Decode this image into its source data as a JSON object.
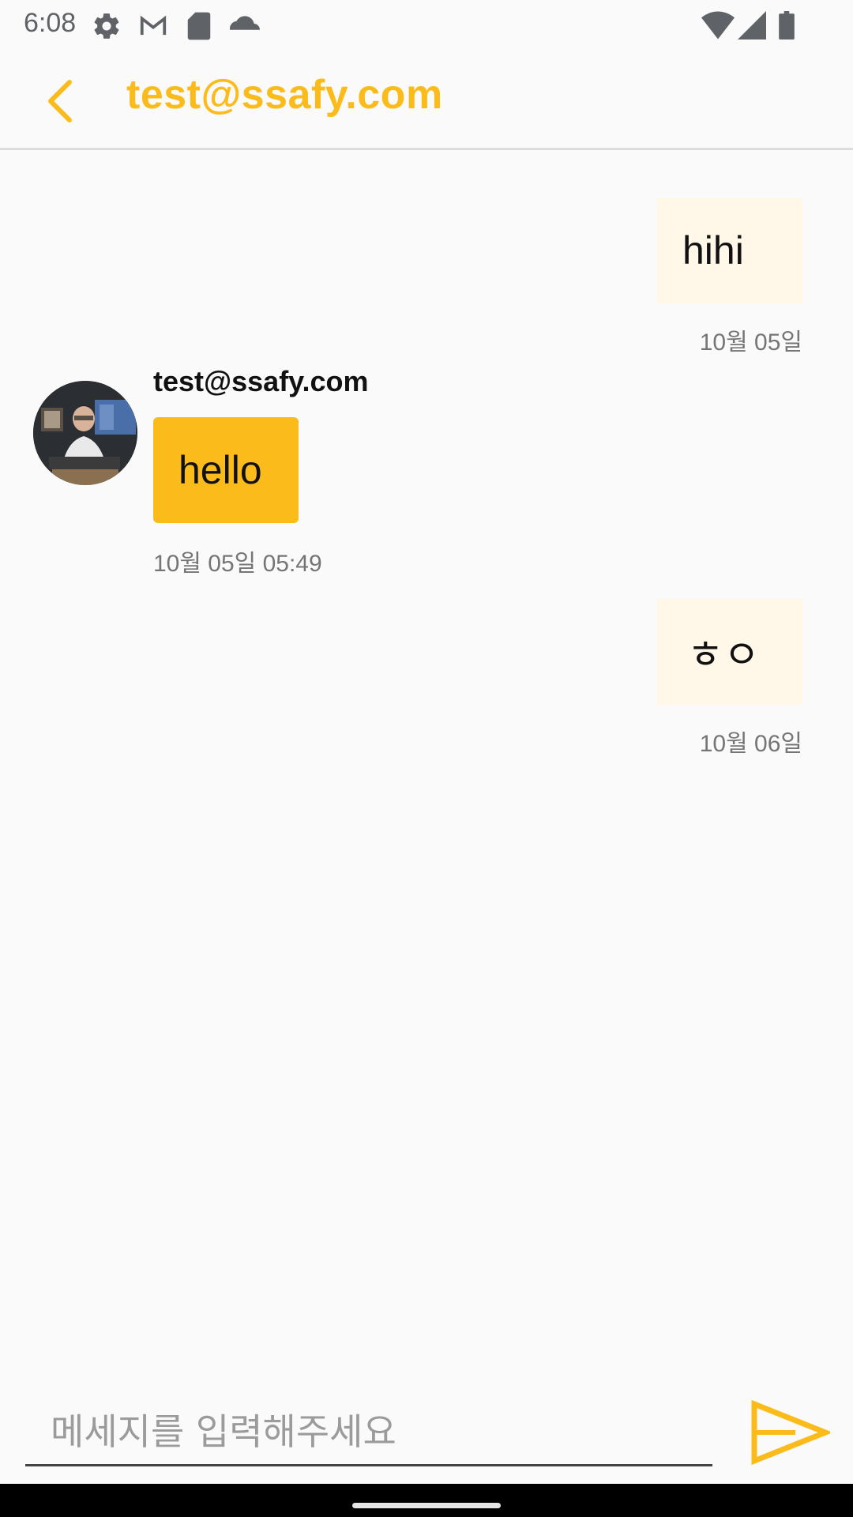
{
  "status_bar": {
    "time": "6:08",
    "icons_left": [
      "settings-icon",
      "gmail-icon",
      "sd-card-icon",
      "cloud-icon"
    ],
    "icons_right": [
      "wifi-icon",
      "signal-icon",
      "battery-icon"
    ]
  },
  "header": {
    "title": "test@ssafy.com",
    "back_icon": "chevron-left-icon",
    "accent_color": "#fbbc1b"
  },
  "messages": [
    {
      "direction": "outgoing",
      "text": "hihi",
      "time": "10월 05일"
    },
    {
      "direction": "incoming",
      "sender": "test@ssafy.com",
      "text": "hello",
      "time": "10월 05일 05:49"
    },
    {
      "direction": "outgoing",
      "text": "ㅎㅇ",
      "time": "10월 06일"
    }
  ],
  "composer": {
    "placeholder": "메세지를 입력해주세요",
    "value": "",
    "send_icon": "send-icon"
  }
}
